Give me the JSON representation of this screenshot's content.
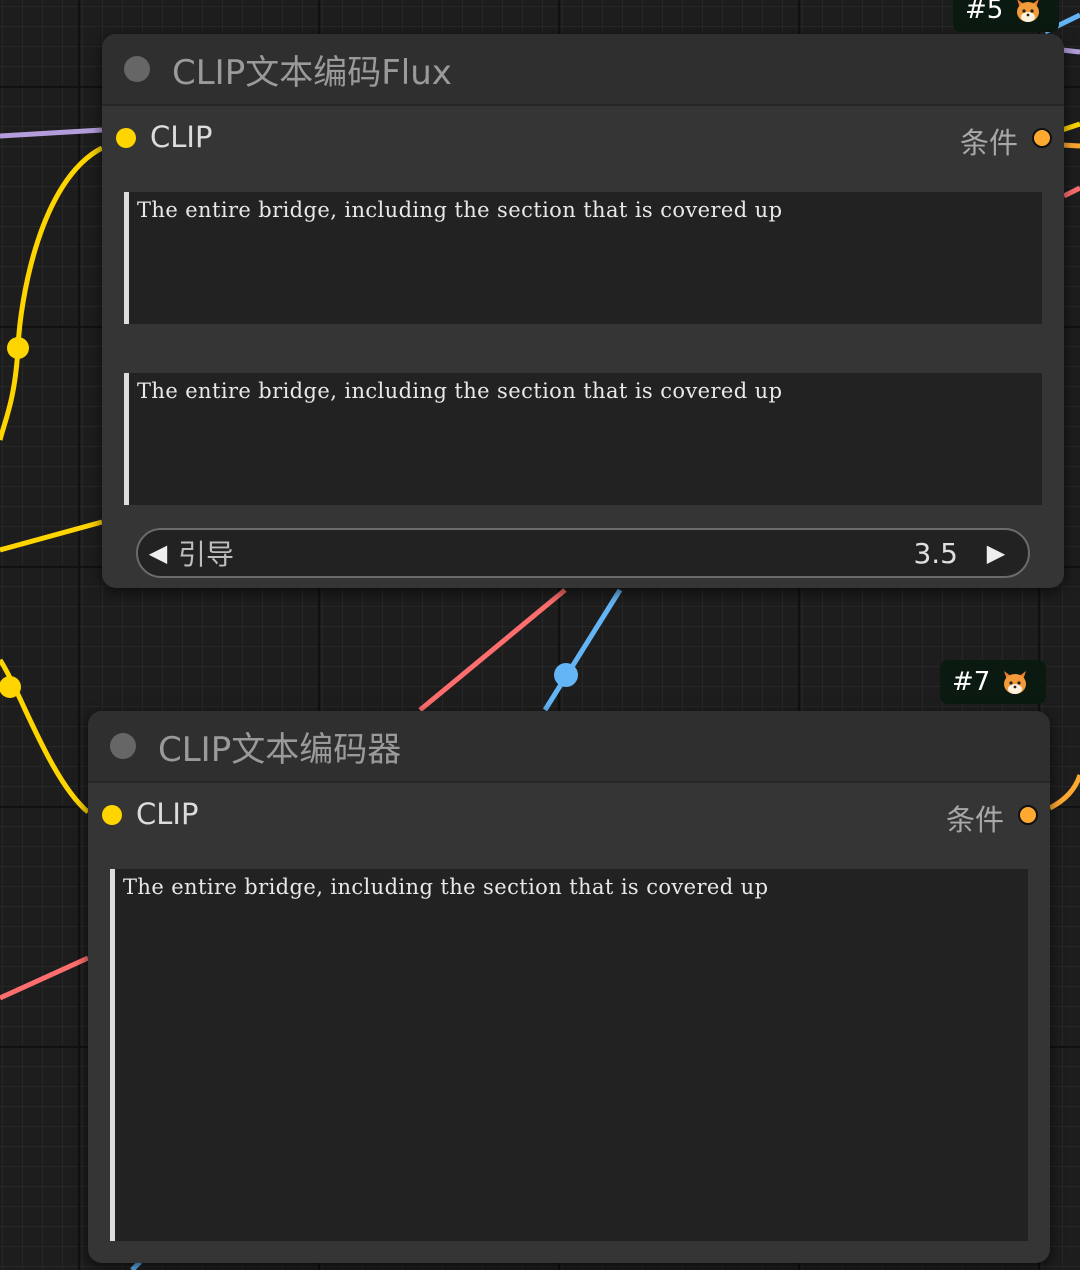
{
  "node_flux": {
    "id_badge": "#5",
    "title": "CLIP文本编码Flux",
    "input_label": "CLIP",
    "output_label": "条件",
    "text_clip_l": "The entire bridge, including the section that is covered up",
    "text_t5xxl": "The entire bridge, including the section that is covered up",
    "guidance": {
      "label": "引导",
      "value": "3.5",
      "decrement": "◀",
      "increment": "▶"
    }
  },
  "node_encoder": {
    "id_badge": "#7",
    "title": "CLIP文本编码器",
    "input_label": "CLIP",
    "output_label": "条件",
    "text": "The entire bridge, including the section that is covered up"
  },
  "colors": {
    "clip_wire": "#ffd500",
    "conditioning_wire": "#ffa931",
    "model_wire": "#b39ddb",
    "latent_wire": "#ff6e6e",
    "vae_wire": "#64b5f6"
  }
}
